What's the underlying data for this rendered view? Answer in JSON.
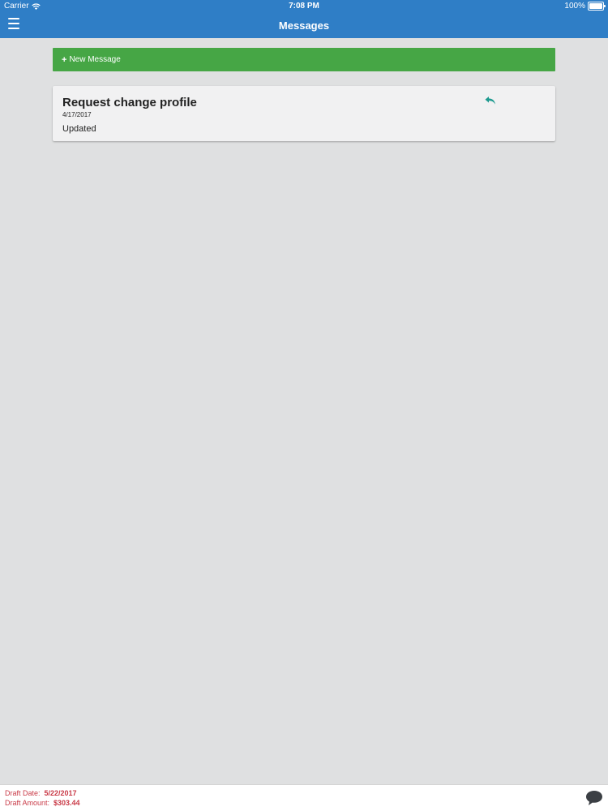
{
  "status": {
    "carrier": "Carrier",
    "time": "7:08 PM",
    "battery": "100%"
  },
  "nav": {
    "title": "Messages",
    "menu_icon": "hamburger-menu-icon"
  },
  "actions": {
    "new_message_label": "New Message",
    "new_message_icon": "plus-icon"
  },
  "messages": [
    {
      "subject": "Request change profile",
      "date": "4/17/2017",
      "body": "Updated",
      "reply_icon": "reply-icon"
    }
  ],
  "footer": {
    "draft_date_label": "Draft Date:",
    "draft_date_value": "5/22/2017",
    "draft_amount_label": "Draft Amount:",
    "draft_amount_value": "$303.44",
    "chat_icon": "chat-bubble-icon"
  },
  "colors": {
    "nav_bg": "#2f7ec6",
    "primary_button": "#46a645",
    "page_bg": "#dfe0e1",
    "card_bg": "#f1f1f2",
    "accent_teal": "#1d9a8f",
    "footer_text": "#c93a47"
  }
}
